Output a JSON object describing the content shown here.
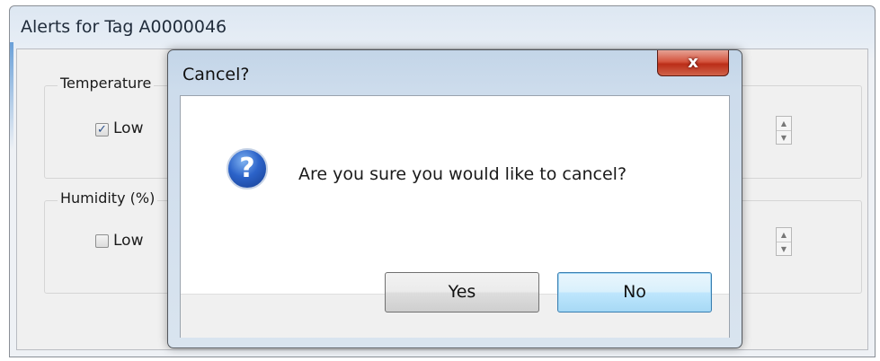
{
  "parent_window": {
    "title": "Alerts for Tag A0000046",
    "groups": [
      {
        "label": "Temperature",
        "checkbox_label": "Low",
        "checked": true
      },
      {
        "label": "Humidity (%)",
        "checkbox_label": "Low",
        "checked": false
      }
    ]
  },
  "dialog": {
    "title": "Cancel?",
    "close_glyph": "x",
    "icon": "question-icon",
    "message": "Are you sure you would like to cancel?",
    "buttons": {
      "yes": "Yes",
      "no": "No"
    },
    "default_button": "No"
  },
  "colors": {
    "close_button_red": "#c73a22",
    "question_icon_blue": "#2c63c9",
    "default_button_border": "#3c7fb1"
  }
}
